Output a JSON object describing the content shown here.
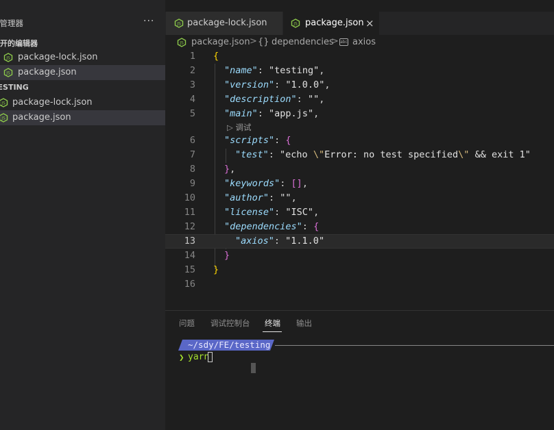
{
  "sidebar": {
    "header_title": "源管理器",
    "more_label": "···",
    "open_editors_title": "打开的编辑器",
    "open_editors": [
      {
        "label": "package-lock.json",
        "selected": false
      },
      {
        "label": "package.json",
        "selected": true
      }
    ],
    "folder_title": "TESTING",
    "folder_files": [
      {
        "label": "package-lock.json",
        "selected": false
      },
      {
        "label": "package.json",
        "selected": true
      }
    ]
  },
  "tabs": [
    {
      "label": "package-lock.json",
      "active": false,
      "icon": "nodejs-icon"
    },
    {
      "label": "package.json",
      "active": true,
      "icon": "nodejs-icon",
      "close": "×"
    }
  ],
  "breadcrumb": {
    "file": "package.json",
    "sep": ">",
    "symbol_prefix": "{}",
    "symbol": "dependencies",
    "leaf_icon_text": "abc",
    "leaf": "axios"
  },
  "editor": {
    "current_line": 13,
    "codelens": "▷ 调试",
    "line_numbers": [
      "1",
      "2",
      "3",
      "4",
      "5",
      "6",
      "7",
      "8",
      "9",
      "10",
      "11",
      "12",
      "13",
      "14",
      "15",
      "16"
    ]
  },
  "code": {
    "l1_open": "{",
    "l2_key": "\"name\"",
    "l2_val": "\"testing\"",
    "l3_key": "\"version\"",
    "l3_val": "\"1.0.0\"",
    "l4_key": "\"description\"",
    "l4_val": "\"\"",
    "l5_key": "\"main\"",
    "l5_val": "\"app.js\"",
    "l6_key": "\"scripts\"",
    "l6_open": "{",
    "l7_key": "\"test\"",
    "l7_val_a": "\"echo ",
    "l7_esc1": "\\\"",
    "l7_val_b": "Error: no test specified",
    "l7_esc2": "\\\"",
    "l7_val_c": " && exit 1\"",
    "l8_close": "}",
    "l9_key": "\"keywords\"",
    "l9_val": "[]",
    "l10_key": "\"author\"",
    "l10_val": "\"\"",
    "l11_key": "\"license\"",
    "l11_val": "\"ISC\"",
    "l12_key": "\"dependencies\"",
    "l12_open": "{",
    "l13_key": "\"axios\"",
    "l13_val": "\"1.1.0\"",
    "l14_close": "}",
    "l15_close": "}",
    "colon": ": ",
    "comma": ","
  },
  "panel": {
    "tabs": [
      {
        "label": "问题",
        "active": false
      },
      {
        "label": "调试控制台",
        "active": false
      },
      {
        "label": "终端",
        "active": true
      },
      {
        "label": "输出",
        "active": false
      }
    ],
    "prompt_path": "~/sdy/FE/testing",
    "prompt_arrow": "❯",
    "command": "yarn"
  },
  "colors": {
    "json_key": "#9cdcfe",
    "bracket_level1": "#ffd700",
    "bracket_level2": "#da70d6",
    "prompt_bg": "#5a67c7",
    "terminal_command": "#a6e22e",
    "node_icon": "#8cc84b"
  }
}
